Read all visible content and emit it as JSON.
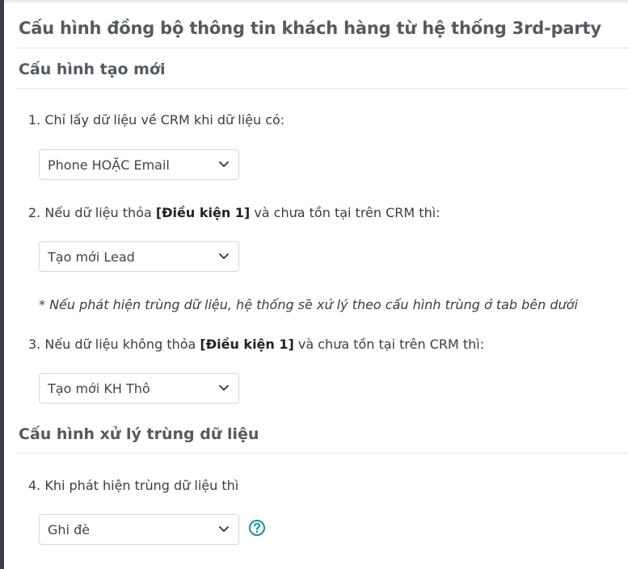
{
  "page": {
    "title": "Cấu hình đồng bộ thông tin khách hàng từ hệ thống 3rd-party"
  },
  "create_section": {
    "title": "Cấu hình tạo mới",
    "q1": {
      "label": "1. Chỉ lấy dữ liệu về CRM khi dữ liệu có:",
      "selected": "Phone HOẶC Email"
    },
    "q2": {
      "label_prefix": "2. Nếu dữ liệu thỏa ",
      "label_bold": "[Điều kiện 1]",
      "label_suffix": " và chưa tồn tại trên CRM thì:",
      "selected": "Tạo mới Lead"
    },
    "note": "* Nếu phát hiện trùng dữ liệu, hệ thống sẽ xử lý theo cấu hình trùng ở tab bên dưới",
    "q3": {
      "label_prefix": "3. Nếu dữ liệu không thỏa ",
      "label_bold": "[Điều kiện 1]",
      "label_suffix": " và chưa tồn tại trên CRM thì:",
      "selected": "Tạo mới KH Thô"
    }
  },
  "duplicate_section": {
    "title": "Cấu hình xử lý trùng dữ liệu",
    "q4": {
      "label": "4. Khi phát hiện trùng dữ liệu thì",
      "selected": "Ghi đè"
    }
  },
  "icons": {
    "dropdown": "chevron-down-icon",
    "help": "question-circle-icon"
  },
  "colors": {
    "help_icon": "#1a8fa0",
    "title_text": "#555a60"
  }
}
